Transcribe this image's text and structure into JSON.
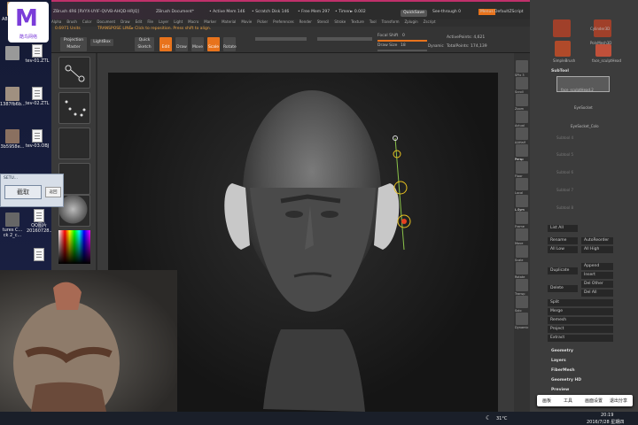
{
  "zbrush": {
    "title": "ZBrush 4R6 [RVYX-UYIF-QVVB-AHQD-HRJQ]",
    "document": "ZBrush Document*",
    "active_mem": "• Active Mem 146",
    "scratch": "• Scratch Disk 146",
    "free_mem": "• Free Mem 297",
    "timer": "• Timer► 0.002",
    "quicksave": "QuickSave",
    "see_through": "See-through 0",
    "menus_btn": "Menus",
    "default_script": "DefaultZScript",
    "menus": [
      "Alpha",
      "Brush",
      "Color",
      "Document",
      "Draw",
      "Edit",
      "File",
      "Layer",
      "Light",
      "Macro",
      "Marker",
      "Material",
      "Movie",
      "Picker",
      "Preferences",
      "Render",
      "Stencil",
      "Stroke",
      "Texture",
      "Tool",
      "Transform",
      "Zplugin",
      "Zscript"
    ],
    "status_units": "0.6971 Units",
    "status_message": "TRANSPOSE LINE▸ Click to reposition. Press shift to align.",
    "shelf": {
      "projection_master": "Projection Master",
      "lightbox": "LightBox",
      "quick_sketch": "Quick Sketch",
      "edit": "Edit",
      "draw": "Draw",
      "move": "Move",
      "scale": "Scale",
      "rotate": "Rotate",
      "focal_shift_label": "Focal Shift",
      "focal_shift_value": "0",
      "draw_size_label": "Draw Size",
      "draw_size_value": "18",
      "dynamic": "Dynamic",
      "active_points": "ActivePoints: 4,621",
      "total_points": "TotalPoints: 174,139",
      "s_smooth": "S.Smooth"
    },
    "right_tools": [
      "SPix 3",
      "Scroll",
      "Zoom",
      "Actual",
      "AAHalf",
      "Persp",
      "Floor",
      "Local",
      "L.Sym",
      "Frame",
      "Move",
      "Scale",
      "Rotate",
      "Transp",
      "Solo",
      "Dynamic"
    ],
    "panel": {
      "top_items": [
        "Cylinder3D",
        "PolyMesh3D",
        "SimpleBrush",
        "face_sculptHead"
      ],
      "subtool": "SubTool",
      "subtool_items": [
        "face_sculptHead.2",
        "EyeSocket",
        "EyeSocket_Colo",
        "Subtool 4",
        "Subtool 5",
        "Subtool 6",
        "Subtool 7",
        "Subtool 8"
      ],
      "list_all": "List All",
      "rename": "Rename",
      "autoreorder": "AutoReorder",
      "all_low": "All Low",
      "all_high": "All High",
      "duplicate": "Duplicate",
      "append": "Append",
      "insert": "Insert",
      "delete": "Delete",
      "del_other": "Del Other",
      "del_all": "Del All",
      "sections": [
        "Split",
        "Merge",
        "Remesh",
        "Project",
        "Extract"
      ],
      "sub_sections": [
        "Geometry",
        "Layers",
        "FiberMesh",
        "Geometry HD",
        "Preview"
      ]
    }
  },
  "desktop": {
    "items": [
      "tev-01.ZTL",
      "tev-02.ZTL",
      "tev-03.OBJ",
      "QQ图片20160728...",
      "A87af608...",
      "1387fb6b...",
      "3b5958e...",
      "tures C...",
      "ck 2_c..."
    ]
  },
  "overlay": {
    "logo_text": "酷鸟网络",
    "setting_button": "截取",
    "setting_small": "返回",
    "setting_title": "SETU..."
  },
  "popup": {
    "items": [
      "画板",
      "工具",
      "画面设置",
      "退出分享"
    ]
  },
  "taskbar": {
    "temp": "31°C",
    "time": "20:19",
    "date": "2016/7/28 星期四"
  },
  "colors": {
    "orange": "#e8731c",
    "title_pink": "#c0306a",
    "viewport": "#151515"
  }
}
